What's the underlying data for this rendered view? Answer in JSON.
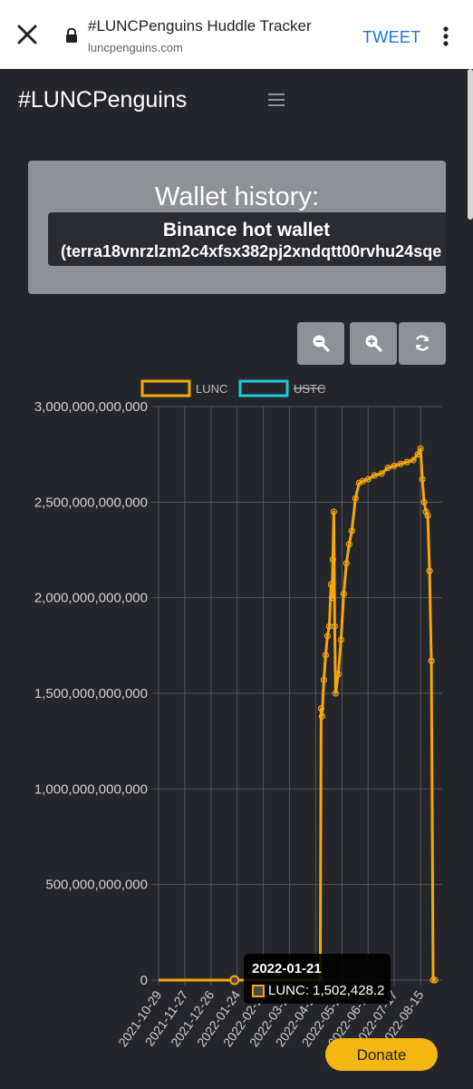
{
  "browser": {
    "page_title": "#LUNCPenguins Huddle Tracker",
    "url": "luncpenguins.com",
    "tweet_label": "TWEET",
    "close_icon": "close-icon",
    "menu_icon": "kebab-menu-icon",
    "accent_color": "#1a73e8"
  },
  "nav": {
    "brand": "#LUNCPenguins",
    "menu_icon": "hamburger-icon"
  },
  "card": {
    "title": "Wallet history:",
    "wallet_name": "Binance hot wallet",
    "wallet_address": "(terra18vnrzlzm2c4xfsx382pj2xndqtt00rvhu24sqe"
  },
  "controls": {
    "zoom_out_icon": "zoom-out-icon",
    "zoom_in_icon": "zoom-in-icon",
    "reset_icon": "refresh-icon"
  },
  "tooltip": {
    "date": "2022-01-21",
    "text": "LUNC: 1,502,428.2"
  },
  "donate_label": "Donate",
  "chart_data": {
    "type": "line",
    "legend": [
      {
        "name": "LUNC",
        "color": "#f5a70d",
        "hidden": false
      },
      {
        "name": "USTC",
        "color": "#1ec8e0",
        "hidden": true
      }
    ],
    "legend_position": "top",
    "ylim": [
      0,
      3000000000000
    ],
    "y_ticks": [
      0,
      500000000000,
      1000000000000,
      1500000000000,
      2000000000000,
      2500000000000,
      3000000000000
    ],
    "y_tick_labels": [
      "0",
      "500,000,000,000",
      "1,000,000,000,000",
      "1,500,000,000,000",
      "2,000,000,000,000",
      "2,500,000,000,000",
      "3,000,000,000,000"
    ],
    "x_tick_labels": [
      "2021-10-29",
      "2021-11-27",
      "2021-12-26",
      "2022-01-24",
      "2022-02-22",
      "2022-03-23",
      "2022-04-21",
      "2022-05-20",
      "2022-06-18",
      "2022-07-17",
      "2022-08-15"
    ],
    "x_range": [
      "2021-10-29",
      "2022-09-08"
    ],
    "grid": true,
    "series": [
      {
        "name": "LUNC",
        "color": "#f5a70d",
        "x": [
          "2021-10-29",
          "2022-01-21",
          "2022-04-26",
          "2022-04-27",
          "2022-04-28",
          "2022-04-30",
          "2022-05-02",
          "2022-05-04",
          "2022-05-06",
          "2022-05-08",
          "2022-05-09",
          "2022-05-10",
          "2022-05-11",
          "2022-05-12",
          "2022-05-13",
          "2022-05-16",
          "2022-05-19",
          "2022-05-22",
          "2022-05-25",
          "2022-05-28",
          "2022-05-31",
          "2022-06-04",
          "2022-06-08",
          "2022-06-12",
          "2022-06-18",
          "2022-06-25",
          "2022-07-03",
          "2022-07-10",
          "2022-07-17",
          "2022-07-24",
          "2022-07-31",
          "2022-08-07",
          "2022-08-12",
          "2022-08-15",
          "2022-08-17",
          "2022-08-19",
          "2022-08-21",
          "2022-08-23",
          "2022-08-25",
          "2022-08-27",
          "2022-08-29",
          "2022-08-31"
        ],
        "values": [
          0,
          1502428.2,
          0,
          1420000000000,
          1380000000000,
          1570000000000,
          1700000000000,
          1800000000000,
          1850000000000,
          2070000000000,
          2000000000000,
          2200000000000,
          2450000000000,
          1850000000000,
          1500000000000,
          1600000000000,
          1780000000000,
          2020000000000,
          2180000000000,
          2280000000000,
          2350000000000,
          2520000000000,
          2600000000000,
          2610000000000,
          2620000000000,
          2640000000000,
          2650000000000,
          2680000000000,
          2690000000000,
          2700000000000,
          2710000000000,
          2720000000000,
          2750000000000,
          2780000000000,
          2620000000000,
          2500000000000,
          2450000000000,
          2430000000000,
          2140000000000,
          1670000000000,
          0,
          0
        ]
      },
      {
        "name": "USTC",
        "color": "#1ec8e0",
        "x": [],
        "values": []
      }
    ]
  }
}
